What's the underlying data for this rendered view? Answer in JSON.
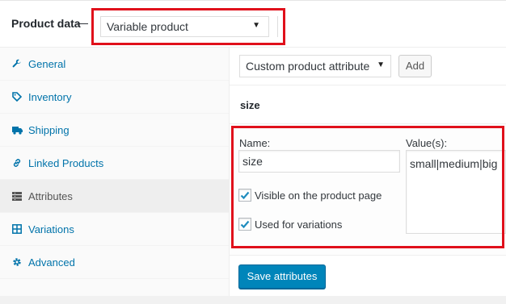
{
  "header": {
    "title": "Product data",
    "dash": "—",
    "product_type": "Variable product"
  },
  "sidebar": {
    "items": [
      {
        "label": "General",
        "icon": "wrench-icon"
      },
      {
        "label": "Inventory",
        "icon": "tag-icon"
      },
      {
        "label": "Shipping",
        "icon": "truck-icon"
      },
      {
        "label": "Linked Products",
        "icon": "link-icon"
      },
      {
        "label": "Attributes",
        "icon": "list-icon",
        "active": true
      },
      {
        "label": "Variations",
        "icon": "grid-icon"
      },
      {
        "label": "Advanced",
        "icon": "gear-icon"
      }
    ]
  },
  "attributes": {
    "selector": "Custom product attribute",
    "add_label": "Add",
    "attribute_heading": "size",
    "name_label": "Name:",
    "name_value": "size",
    "values_label": "Value(s):",
    "values_value": "small|medium|big",
    "visible_label": "Visible on the product page",
    "visible_checked": true,
    "variations_label": "Used for variations",
    "variations_checked": true,
    "save_label": "Save attributes"
  },
  "colors": {
    "highlight": "#e0101b",
    "link": "#0073aa",
    "primary": "#0085ba"
  }
}
